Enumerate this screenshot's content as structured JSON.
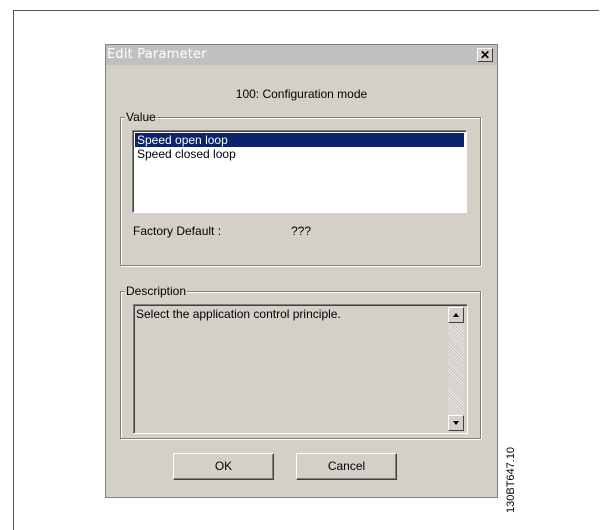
{
  "dialog": {
    "title": "Edit Parameter",
    "close_symbol": "✕",
    "parameter_title": "100: Configuration mode"
  },
  "value_group": {
    "label": "Value",
    "options": [
      {
        "label": "Speed open loop",
        "selected": true
      },
      {
        "label": "Speed closed loop",
        "selected": false
      }
    ],
    "factory_default_label": "Factory Default :",
    "factory_default_value": "???"
  },
  "description_group": {
    "label": "Description",
    "text": "Select the application control principle."
  },
  "buttons": {
    "ok_label": "OK",
    "cancel_label": "Cancel"
  },
  "figure_code": "130BT647.10",
  "icons": {
    "close": "close-icon",
    "scroll_up": "scroll-up-arrow-icon",
    "scroll_down": "scroll-down-arrow-icon"
  },
  "colors": {
    "dialog_bg": "#d4d0c8",
    "selection_bg": "#0a246a",
    "titlebar_bg": "#c0c0c0"
  }
}
